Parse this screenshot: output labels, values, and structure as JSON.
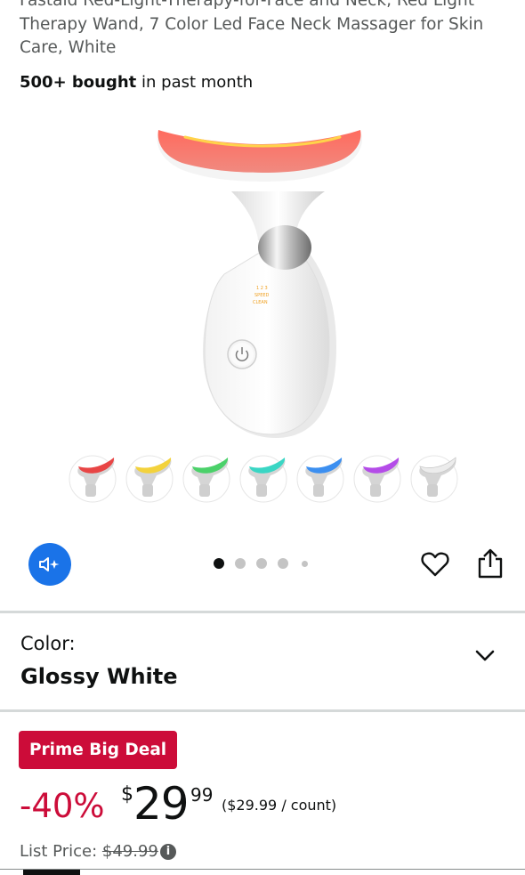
{
  "product": {
    "title": "Fastaid Red-Light-Therapy-for-Face and Neck, Red Light Therapy Wand, 7 Color Led Face Neck Massager for Skin Care, White",
    "bought_bold": "500+ bought",
    "bought_rest": " in past month",
    "device_panel_text": [
      "1 2 3",
      "SPEED",
      "CLEAN"
    ]
  },
  "gallery": {
    "thumbnail_colors": [
      "#e84545",
      "#f3d23c",
      "#4bd16a",
      "#3ad6c4",
      "#3c8ff0",
      "#b44ce8",
      "#d9d9d9"
    ],
    "dots_total": 5,
    "active_dot": 0
  },
  "colors": {
    "accent_blue": "#1a73e8",
    "deal_red": "#cc0c39",
    "text_primary": "#0f1111",
    "text_secondary": "#565959"
  },
  "variant": {
    "label": "Color:",
    "value": "Glossy White"
  },
  "pricing": {
    "badge": "Prime Big Deal",
    "discount": "-40%",
    "currency": "$",
    "whole": "29",
    "fraction": "99",
    "per_unit": "($29.99 / count)",
    "list_label": "List Price: ",
    "list_value": "$49.99"
  },
  "icons": {
    "sound": "speaker-sparkle-icon",
    "wishlist": "heart-icon",
    "share": "share-icon",
    "expand": "chevron-down-icon",
    "info": "info-icon"
  }
}
